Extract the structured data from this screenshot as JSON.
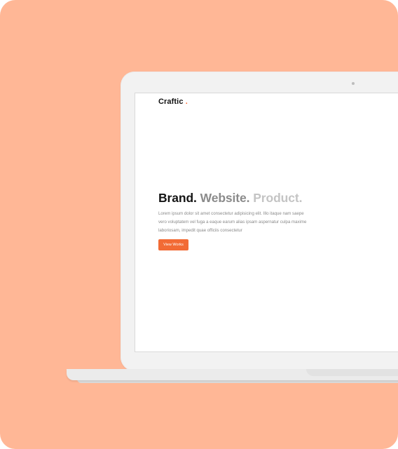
{
  "site": {
    "logo_text": "Craftic",
    "logo_dot": "."
  },
  "hero": {
    "headline_part1": "Brand.",
    "headline_part2": "Website.",
    "headline_part3": "Product.",
    "description": "Lorem ipsum dolor sit amet consectetur adipisicing elit. Illo itaque nam saepe vero voluptatem vel fuga a eaque earum alias ipsam aspernatur culpa maxime laboriosam, impedit quae officiis consectetur",
    "button_label": "View Works"
  },
  "colors": {
    "background": "#ffb796",
    "accent": "#f26b35",
    "headline_dark": "#151515",
    "headline_mid": "#8b8b8b",
    "headline_light": "#c4c4c4"
  }
}
